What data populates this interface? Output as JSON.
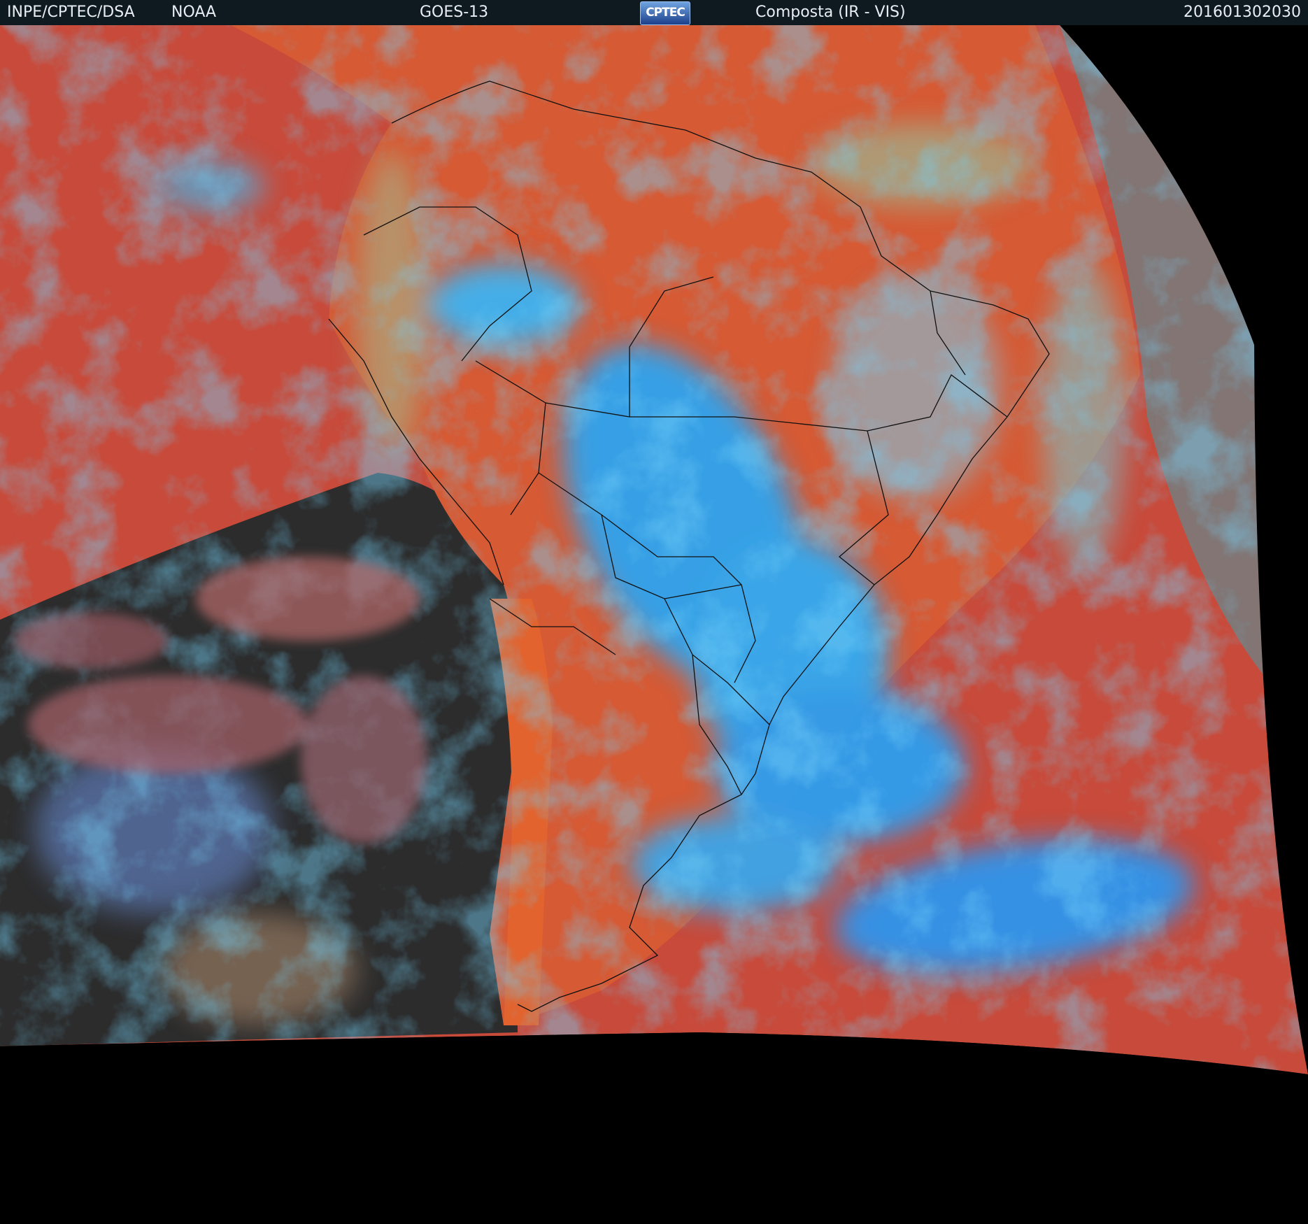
{
  "header": {
    "institution": "INPE/CPTEC/DSA",
    "agency": "NOAA",
    "satellite": "GOES-13",
    "logo_text": "CPTEC",
    "product": "Composta (IR - VIS)",
    "timestamp": "201601302030"
  },
  "colors": {
    "header_bg": "#0f1a20",
    "space": "#000000",
    "clear_ocean": "#c84a3a",
    "clear_land": "#d95a32",
    "cold_cloud": "#2ea4f0",
    "low_cloud": "#8cc7a0",
    "night_vis": "#6d6d6d",
    "boundaries": "#101010"
  }
}
